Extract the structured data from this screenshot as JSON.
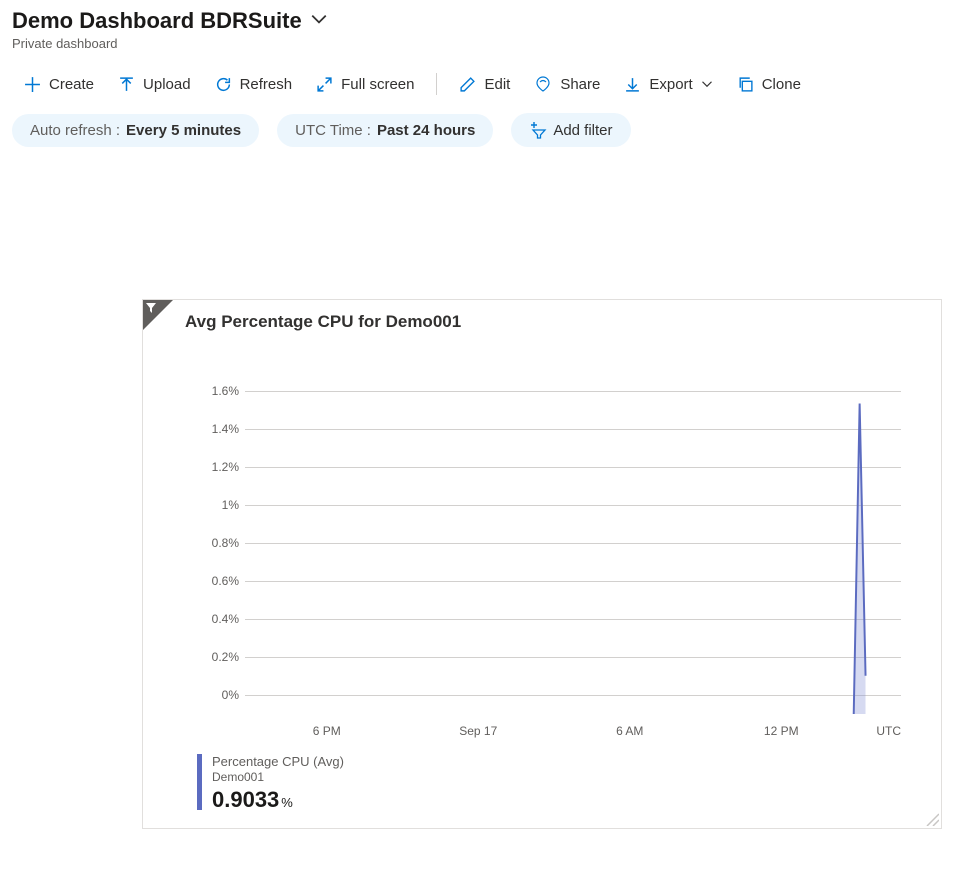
{
  "header": {
    "title": "Demo Dashboard BDRSuite",
    "subtitle": "Private dashboard"
  },
  "toolbar": {
    "create": "Create",
    "upload": "Upload",
    "refresh": "Refresh",
    "fullscreen": "Full screen",
    "edit": "Edit",
    "share": "Share",
    "export": "Export",
    "clone": "Clone"
  },
  "pills": {
    "auto_refresh_label": "Auto refresh : ",
    "auto_refresh_value": "Every 5 minutes",
    "time_label": "UTC Time : ",
    "time_value": "Past 24 hours",
    "add_filter": "Add filter"
  },
  "tile": {
    "title": "Avg Percentage CPU for Demo001"
  },
  "legend": {
    "name": "Percentage CPU (Avg)",
    "resource": "Demo001",
    "value": "0.9033",
    "unit": "%"
  },
  "chart_data": {
    "type": "line",
    "title": "Avg Percentage CPU for Demo001",
    "xlabel": "",
    "ylabel": "",
    "ylim": [
      0,
      1.6
    ],
    "y_ticks": [
      "1.6%",
      "1.4%",
      "1.2%",
      "1%",
      "0.8%",
      "0.6%",
      "0.4%",
      "0.2%",
      "0%"
    ],
    "x_ticks": [
      "6 PM",
      "Sep 17",
      "6 AM",
      "12 PM",
      "UTC"
    ],
    "series": [
      {
        "name": "Percentage CPU (Avg)",
        "resource": "Demo001",
        "summary_value": 0.9033,
        "unit": "%",
        "x": [
          "6 PM",
          "Sep 17",
          "6 AM",
          "12 PM",
          "≈4 PM",
          "≈4:05 PM",
          "≈4:10 PM"
        ],
        "values": [
          null,
          null,
          null,
          null,
          0.0,
          1.45,
          0.18
        ]
      }
    ]
  }
}
